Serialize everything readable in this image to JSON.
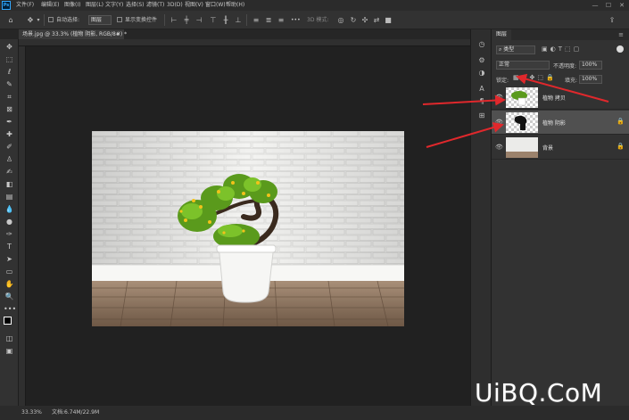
{
  "menubar": {
    "logo": "Ps",
    "items": [
      "文件(F)",
      "编辑(E)",
      "图像(I)",
      "图层(L)",
      "文字(Y)",
      "选择(S)",
      "滤镜(T)",
      "3D(D)",
      "视图(V)",
      "窗口(W)",
      "帮助(H)"
    ]
  },
  "window_controls": [
    "—",
    "☐",
    "✕"
  ],
  "options": {
    "auto_select_label": "自动选择:",
    "auto_select_value": "图层",
    "show_transform_label": "显示变换控件",
    "more": "•••",
    "mode3d_label": "3D 模式:"
  },
  "document": {
    "tab_title": "场景.jpg @ 33.3% (植物 阴影, RGB/8#) *",
    "tab_close": "×"
  },
  "status": {
    "zoom": "33.33%",
    "doc_info": "文档:6.74M/22.9M"
  },
  "layers_panel": {
    "title": "图层",
    "filter_label": "类型",
    "blend_mode": "正常",
    "opacity_label": "不透明度:",
    "opacity_value": "100%",
    "lock_label": "锁定:",
    "fill_label": "填充:",
    "fill_value": "100%",
    "layers": [
      {
        "name": "植物 拷贝",
        "selected": false
      },
      {
        "name": "植物 阴影",
        "selected": true
      },
      {
        "name": "背景",
        "selected": false
      }
    ]
  },
  "watermark": "UiBQ.CoM",
  "colors": {
    "accent": "#31a8ff",
    "arrow": "#e0282c",
    "canvas_bg": "#212121",
    "panel_bg": "#323232"
  }
}
